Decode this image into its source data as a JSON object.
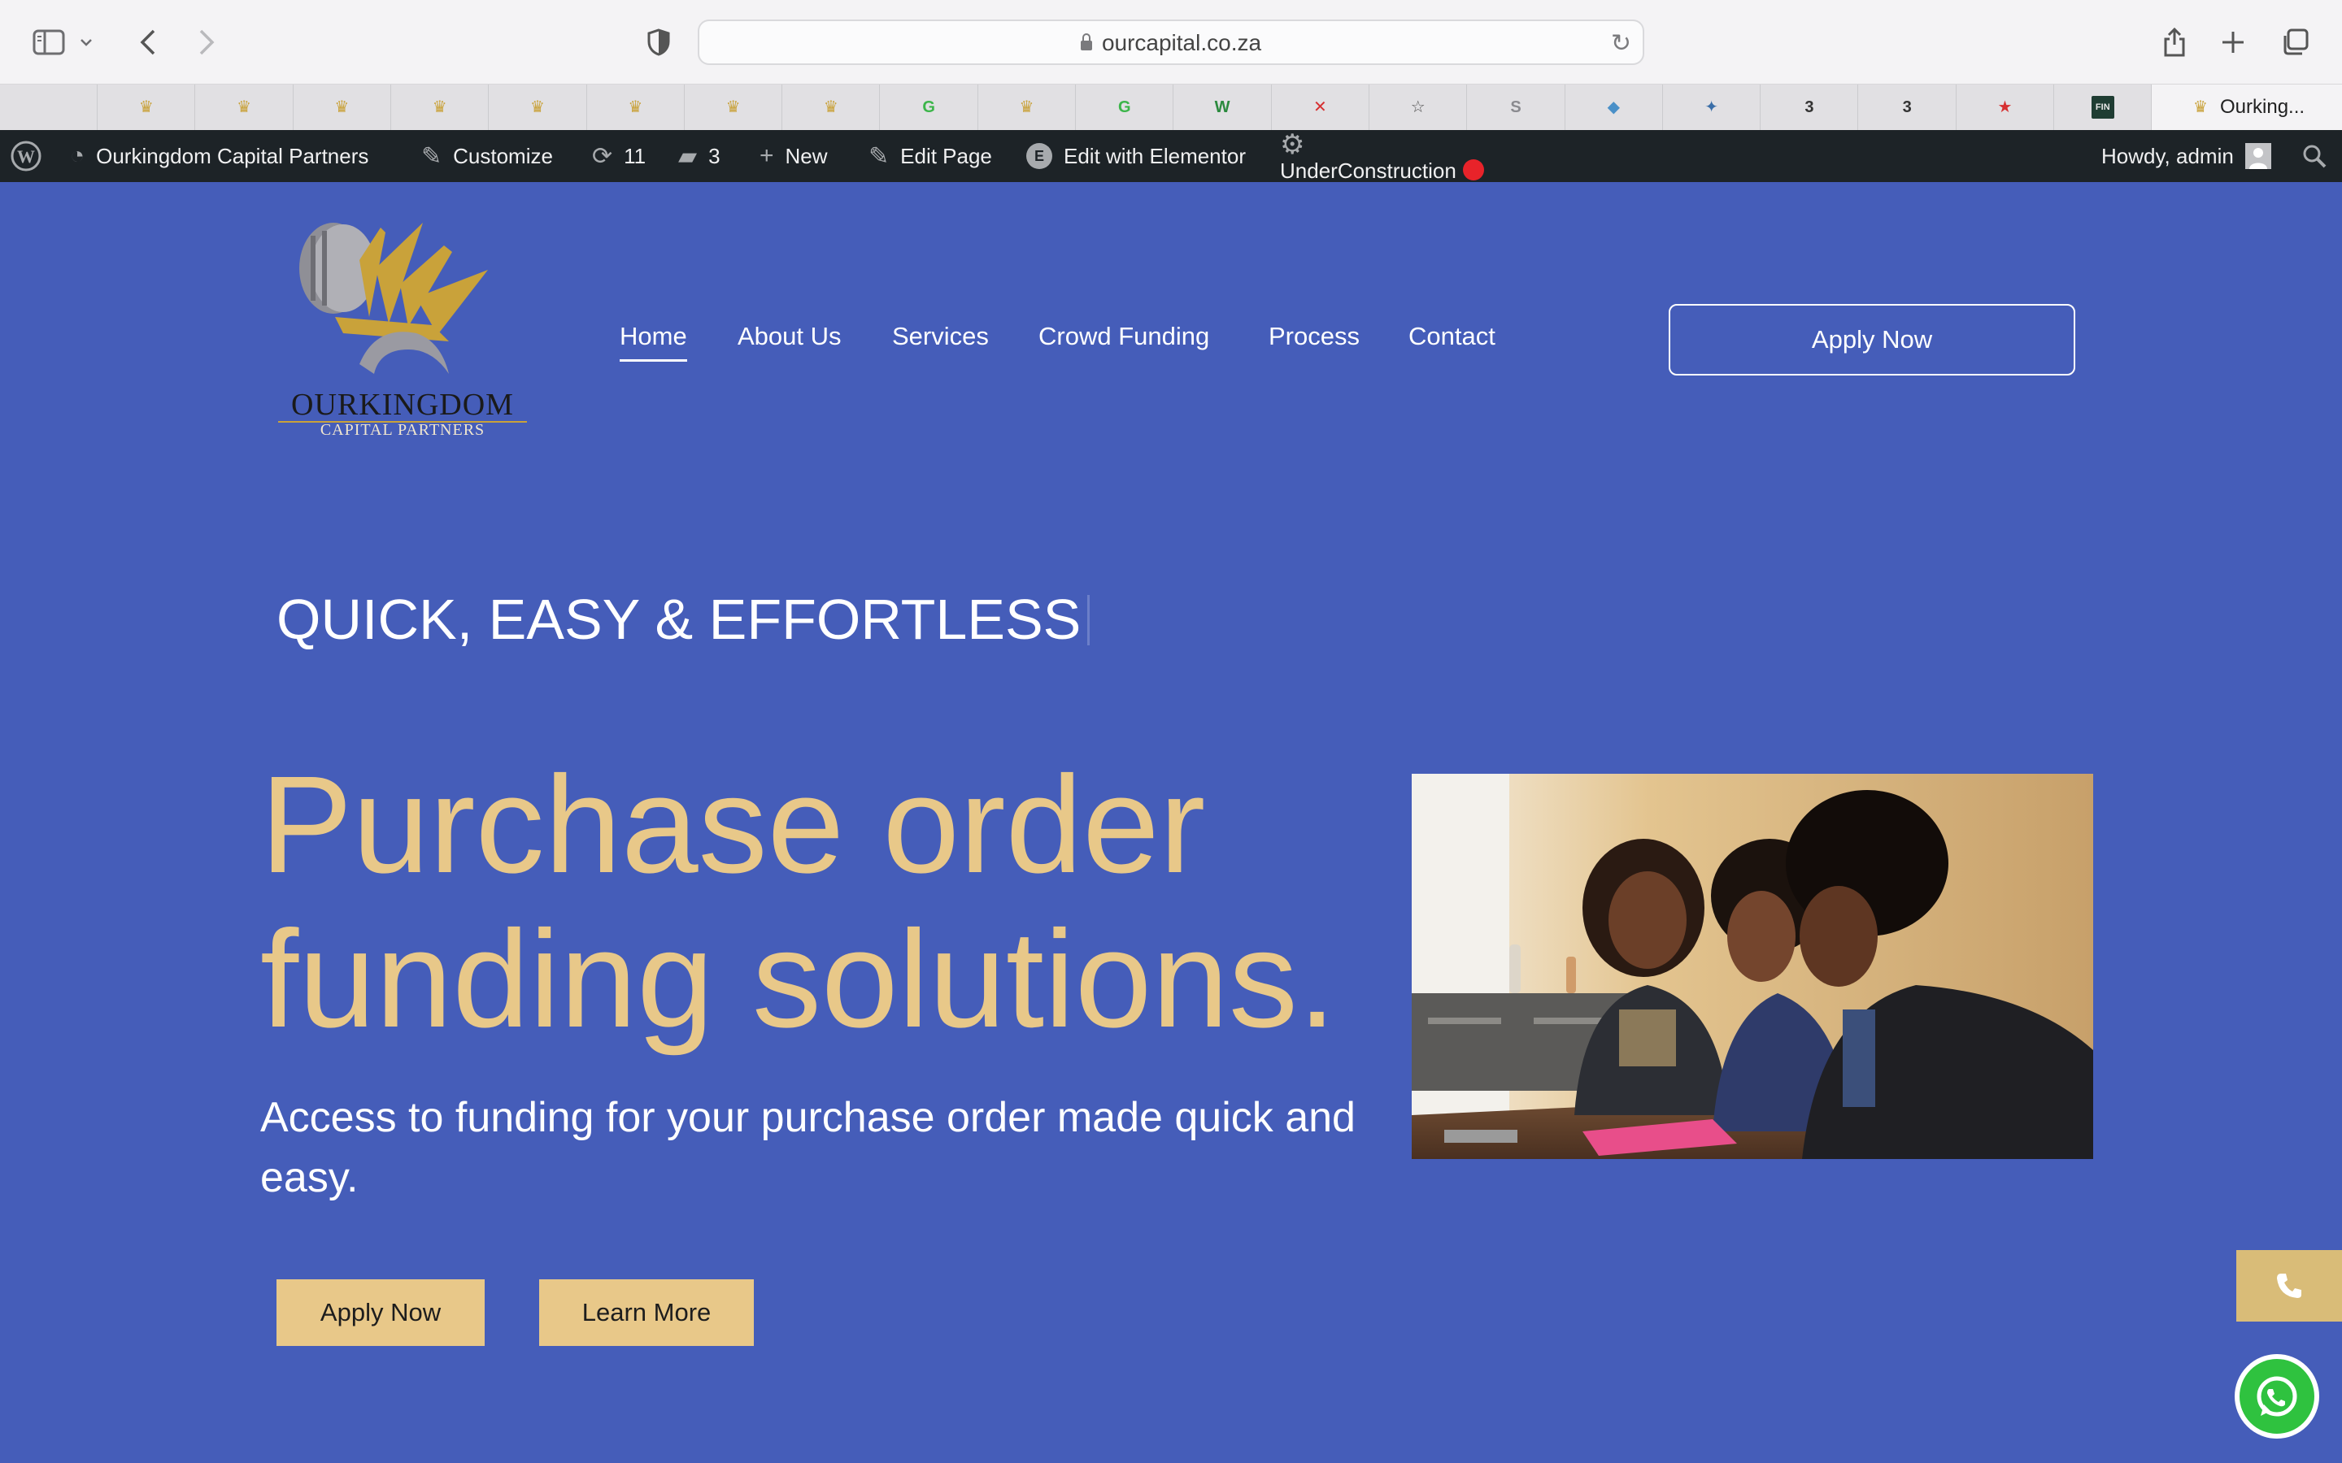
{
  "browser": {
    "url": "ourcapital.co.za",
    "active_tab_title": "Ourking...",
    "icons": {
      "sidebar": "sidebar-icon",
      "back": "back-icon",
      "forward": "forward-icon",
      "shield": "privacy-shield-icon",
      "reload": "reload-icon",
      "share": "share-icon",
      "new_tab": "plus-icon",
      "tabs_overview": "tabs-overview-icon"
    },
    "favorites": [
      {
        "glyph": "",
        "color": "#7a7a7a"
      },
      {
        "glyph": "♛",
        "color": "#c9a23a"
      },
      {
        "glyph": "♛",
        "color": "#c9a23a"
      },
      {
        "glyph": "♛",
        "color": "#c9a23a"
      },
      {
        "glyph": "♛",
        "color": "#c9a23a"
      },
      {
        "glyph": "♛",
        "color": "#c9a23a"
      },
      {
        "glyph": "♛",
        "color": "#c9a23a"
      },
      {
        "glyph": "♛",
        "color": "#c9a23a"
      },
      {
        "glyph": "♛",
        "color": "#c9a23a"
      },
      {
        "glyph": "G",
        "color": "#3cb54a"
      },
      {
        "glyph": "♛",
        "color": "#c9a23a"
      },
      {
        "glyph": "G",
        "color": "#3cb54a"
      },
      {
        "glyph": "W",
        "color": "#2b8a3e"
      },
      {
        "glyph": "✕",
        "color": "#d63031"
      },
      {
        "glyph": "☆",
        "color": "#555555"
      },
      {
        "glyph": "S",
        "color": "#8a8a8f"
      },
      {
        "glyph": "◆",
        "color": "#4a90c8"
      },
      {
        "glyph": "✦",
        "color": "#3a6ea8"
      },
      {
        "glyph": "3",
        "color": "#333333"
      },
      {
        "glyph": "3",
        "color": "#333333"
      },
      {
        "glyph": "★",
        "color": "#d63031"
      },
      {
        "glyph": "FIN",
        "color": "#1f3d33"
      }
    ]
  },
  "adminbar": {
    "site_name": "Ourkingdom Capital Partners",
    "customize": "Customize",
    "updates": "11",
    "comments": "3",
    "new": "New",
    "edit_page": "Edit Page",
    "edit_elementor": "Edit with Elementor",
    "under_construction": "UnderConstruction",
    "howdy": "Howdy, admin"
  },
  "logo": {
    "title": "Ourkingdom",
    "subtitle": "CAPITAL PARTNERS",
    "colors": {
      "gold": "#c9a23a",
      "silver": "#9a9aa2"
    }
  },
  "nav": {
    "items": [
      "Home",
      "About Us",
      "Services",
      "Crowd Funding",
      "Process",
      "Contact"
    ],
    "active": "Home",
    "apply": "Apply Now"
  },
  "hero": {
    "kicker": "QUICK, EASY & EFFORTLESS",
    "headline_line1": "Purchase order",
    "headline_line2": "funding solutions.",
    "subline": "Access to funding for your purchase order made quick and easy.",
    "apply_button": "Apply Now",
    "learn_button": "Learn More",
    "photo_icon": "team-meeting-photo"
  },
  "floating": {
    "phone_icon": "phone-icon",
    "whatsapp_icon": "whatsapp-icon"
  },
  "colors": {
    "page_bg": "#455db9",
    "gold": "#e8c889",
    "admin_bar": "#1d2327"
  }
}
